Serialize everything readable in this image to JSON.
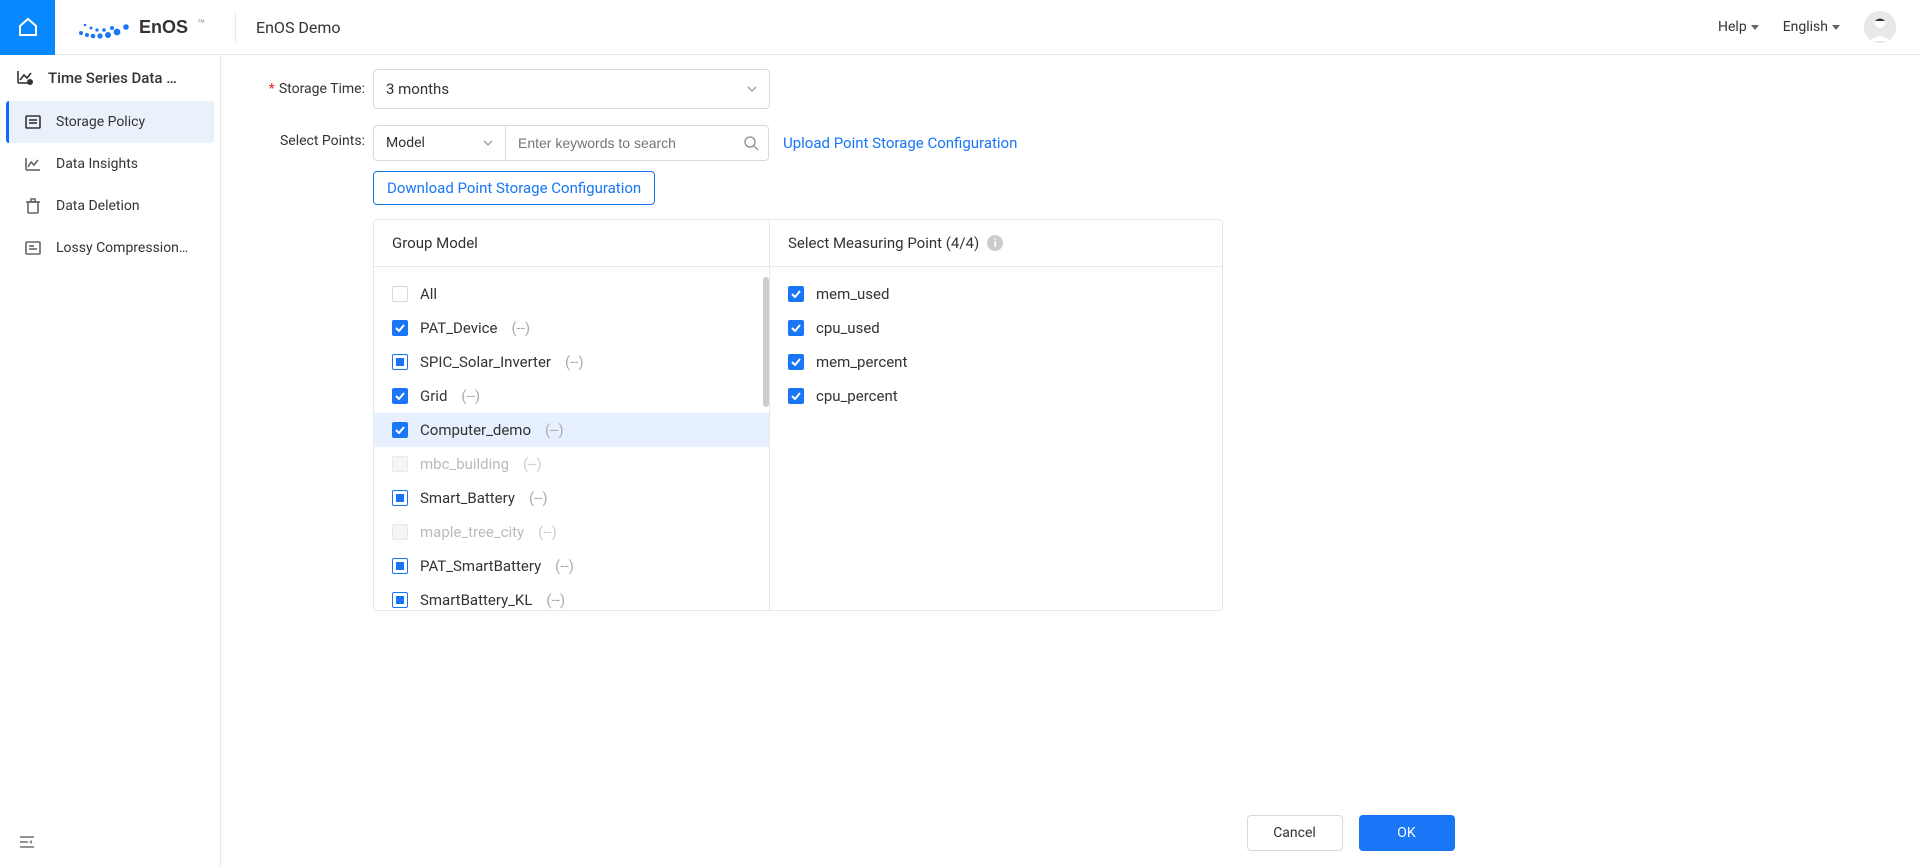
{
  "header": {
    "app_title": "EnOS Demo",
    "help": "Help",
    "language": "English"
  },
  "sidebar": {
    "title": "Time Series Data …",
    "items": [
      {
        "label": "Storage Policy",
        "active": true
      },
      {
        "label": "Data Insights",
        "active": false
      },
      {
        "label": "Data Deletion",
        "active": false
      },
      {
        "label": "Lossy Compression…",
        "active": false
      }
    ]
  },
  "form": {
    "storage_time_label": "Storage Time:",
    "storage_time_value": "3 months",
    "select_points_label": "Select Points:",
    "model_select": "Model",
    "search_placeholder": "Enter keywords to search",
    "upload_link": "Upload Point Storage Configuration",
    "download_link": "Download Point Storage Configuration"
  },
  "transfer": {
    "left_header": "Group Model",
    "right_header": "Select Measuring Point (4/4)",
    "models": [
      {
        "name": "All",
        "suffix": "",
        "state": "unchecked",
        "selected": false,
        "disabled": false
      },
      {
        "name": "PAT_Device",
        "suffix": " (--)",
        "state": "checked",
        "selected": false,
        "disabled": false
      },
      {
        "name": "SPIC_Solar_Inverter",
        "suffix": " (--)",
        "state": "indeterminate",
        "selected": false,
        "disabled": false
      },
      {
        "name": "Grid",
        "suffix": " (--)",
        "state": "checked",
        "selected": false,
        "disabled": false
      },
      {
        "name": "Computer_demo",
        "suffix": " (--)",
        "state": "checked",
        "selected": true,
        "disabled": false
      },
      {
        "name": "mbc_building",
        "suffix": " (--)",
        "state": "disabled",
        "selected": false,
        "disabled": true
      },
      {
        "name": "Smart_Battery",
        "suffix": " (--)",
        "state": "indeterminate",
        "selected": false,
        "disabled": false
      },
      {
        "name": "maple_tree_city",
        "suffix": " (--)",
        "state": "disabled",
        "selected": false,
        "disabled": true
      },
      {
        "name": "PAT_SmartBattery",
        "suffix": " (--)",
        "state": "indeterminate",
        "selected": false,
        "disabled": false
      },
      {
        "name": "SmartBattery_KL",
        "suffix": " (--)",
        "state": "indeterminate",
        "selected": false,
        "disabled": false
      }
    ],
    "points": [
      {
        "name": "mem_used",
        "state": "checked"
      },
      {
        "name": "cpu_used",
        "state": "checked"
      },
      {
        "name": "mem_percent",
        "state": "checked"
      },
      {
        "name": "cpu_percent",
        "state": "checked"
      }
    ]
  },
  "actions": {
    "cancel": "Cancel",
    "ok": "OK"
  }
}
